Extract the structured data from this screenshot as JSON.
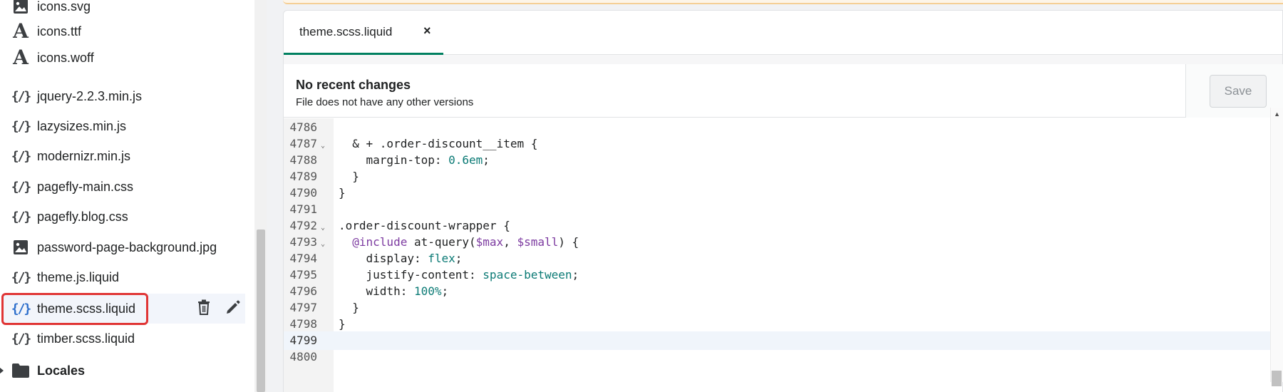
{
  "sidebar": {
    "files": [
      {
        "name": "icons.svg",
        "icon": "image-icon"
      },
      {
        "name": "icons.ttf",
        "icon": "font-icon"
      },
      {
        "name": "icons.woff",
        "icon": "font-icon"
      },
      {
        "name": "jquery-2.2.3.min.js",
        "icon": "code-icon"
      },
      {
        "name": "lazysizes.min.js",
        "icon": "code-icon"
      },
      {
        "name": "modernizr.min.js",
        "icon": "code-icon"
      },
      {
        "name": "pagefly-main.css",
        "icon": "code-icon"
      },
      {
        "name": "pagefly.blog.css",
        "icon": "code-icon"
      },
      {
        "name": "password-page-background.jpg",
        "icon": "image-icon"
      },
      {
        "name": "theme.js.liquid",
        "icon": "code-icon"
      },
      {
        "name": "theme.scss.liquid",
        "icon": "code-icon",
        "selected": true
      },
      {
        "name": "timber.scss.liquid",
        "icon": "code-icon"
      }
    ],
    "folder": {
      "name": "Locales",
      "icon": "folder-icon"
    }
  },
  "editor": {
    "tab_label": "theme.scss.liquid",
    "tab_close": "×",
    "status_title": "No recent changes",
    "status_subtitle": "File does not have any other versions",
    "save_label": "Save",
    "lines": [
      {
        "num": "4786",
        "code": ""
      },
      {
        "num": "4787",
        "code": "  & + .order-discount__item {",
        "fold": true
      },
      {
        "num": "4788",
        "code": "    margin-top: 0.6em;"
      },
      {
        "num": "4789",
        "code": "  }"
      },
      {
        "num": "4790",
        "code": "}"
      },
      {
        "num": "4791",
        "code": ""
      },
      {
        "num": "4792",
        "code": ".order-discount-wrapper {",
        "fold": true
      },
      {
        "num": "4793",
        "code": "  @include at-query($max, $small) {",
        "fold": true
      },
      {
        "num": "4794",
        "code": "    display: flex;"
      },
      {
        "num": "4795",
        "code": "    justify-content: space-between;"
      },
      {
        "num": "4796",
        "code": "    width: 100%;"
      },
      {
        "num": "4797",
        "code": "  }"
      },
      {
        "num": "4798",
        "code": "}"
      },
      {
        "num": "4799",
        "code": "",
        "current": true
      },
      {
        "num": "4800",
        "code": ""
      }
    ]
  },
  "colors": {
    "accent": "#008060",
    "selection_outline": "#e03535",
    "link_blue": "#2c6ecb"
  }
}
